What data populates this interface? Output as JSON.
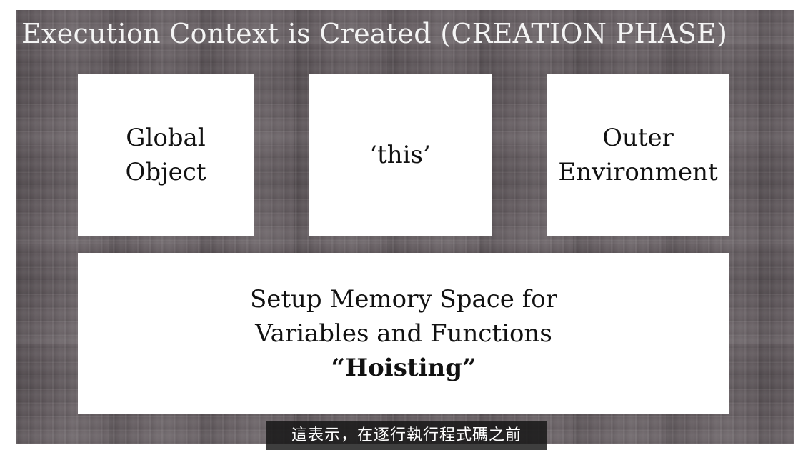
{
  "slide": {
    "title": "Execution Context is Created (CREATION PHASE)",
    "boxes": {
      "global_object": {
        "line1": "Global",
        "line2": "Object"
      },
      "this": {
        "label": "‘this’"
      },
      "outer_environment": {
        "line1": "Outer",
        "line2": "Environment"
      },
      "memory": {
        "line1": "Setup Memory Space for",
        "line2": "Variables and Functions",
        "line3": "“Hoisting”"
      }
    }
  },
  "caption": {
    "text": "這表示，在逐行執行程式碼之前"
  },
  "colors": {
    "slide_background": "#635b5f",
    "box_fill": "#ffffff",
    "title_text": "#f4f4f4",
    "caption_background": "#141414"
  }
}
